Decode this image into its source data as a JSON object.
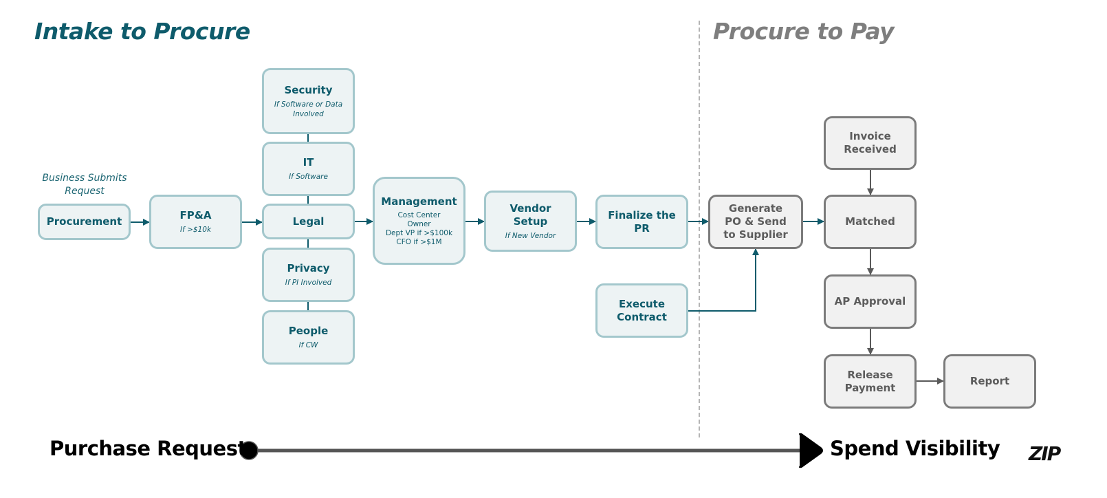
{
  "sections": {
    "left_title": "Intake to Procure",
    "right_title": "Procure to Pay"
  },
  "note": "Business Submits Request",
  "colors": {
    "teal_text": "#0e5b6b",
    "teal_border": "#a3c7cc",
    "teal_fill": "#edf3f4",
    "gray_text": "#5c5c5c",
    "gray_border": "#7b7b7b",
    "gray_fill": "#f1f1f1",
    "teal_arrow": "#0e5b6b",
    "gray_arrow": "#5a5a5a"
  },
  "steps": {
    "procurement": {
      "label": "Procurement"
    },
    "fpa": {
      "label": "FP&A",
      "sub": "If >$10k"
    },
    "security": {
      "label": "Security",
      "sub": "If Software or Data Involved"
    },
    "it": {
      "label": "IT",
      "sub": "If Software"
    },
    "legal": {
      "label": "Legal"
    },
    "privacy": {
      "label": "Privacy",
      "sub": "If PI Involved"
    },
    "people": {
      "label": "People",
      "sub": "If CW"
    },
    "management": {
      "label": "Management",
      "details": [
        "Cost Center",
        "Owner",
        "Dept VP if >$100k",
        "CFO if >$1M"
      ]
    },
    "vendor_setup": {
      "label": "Vendor Setup",
      "sub": "If New Vendor"
    },
    "finalize_pr": {
      "label": "Finalize the PR"
    },
    "execute_contract": {
      "label": "Execute Contract"
    },
    "generate_po": {
      "label": "Generate PO & Send to Supplier"
    },
    "invoice_received": {
      "label": "Invoice Received"
    },
    "matched": {
      "label": "Matched"
    },
    "ap_approval": {
      "label": "AP Approval"
    },
    "release_payment": {
      "label": "Release Payment"
    },
    "report": {
      "label": "Report"
    }
  },
  "timeline": {
    "start_label": "Purchase Request",
    "end_label": "Spend Visibility"
  },
  "logo": "ZIP"
}
